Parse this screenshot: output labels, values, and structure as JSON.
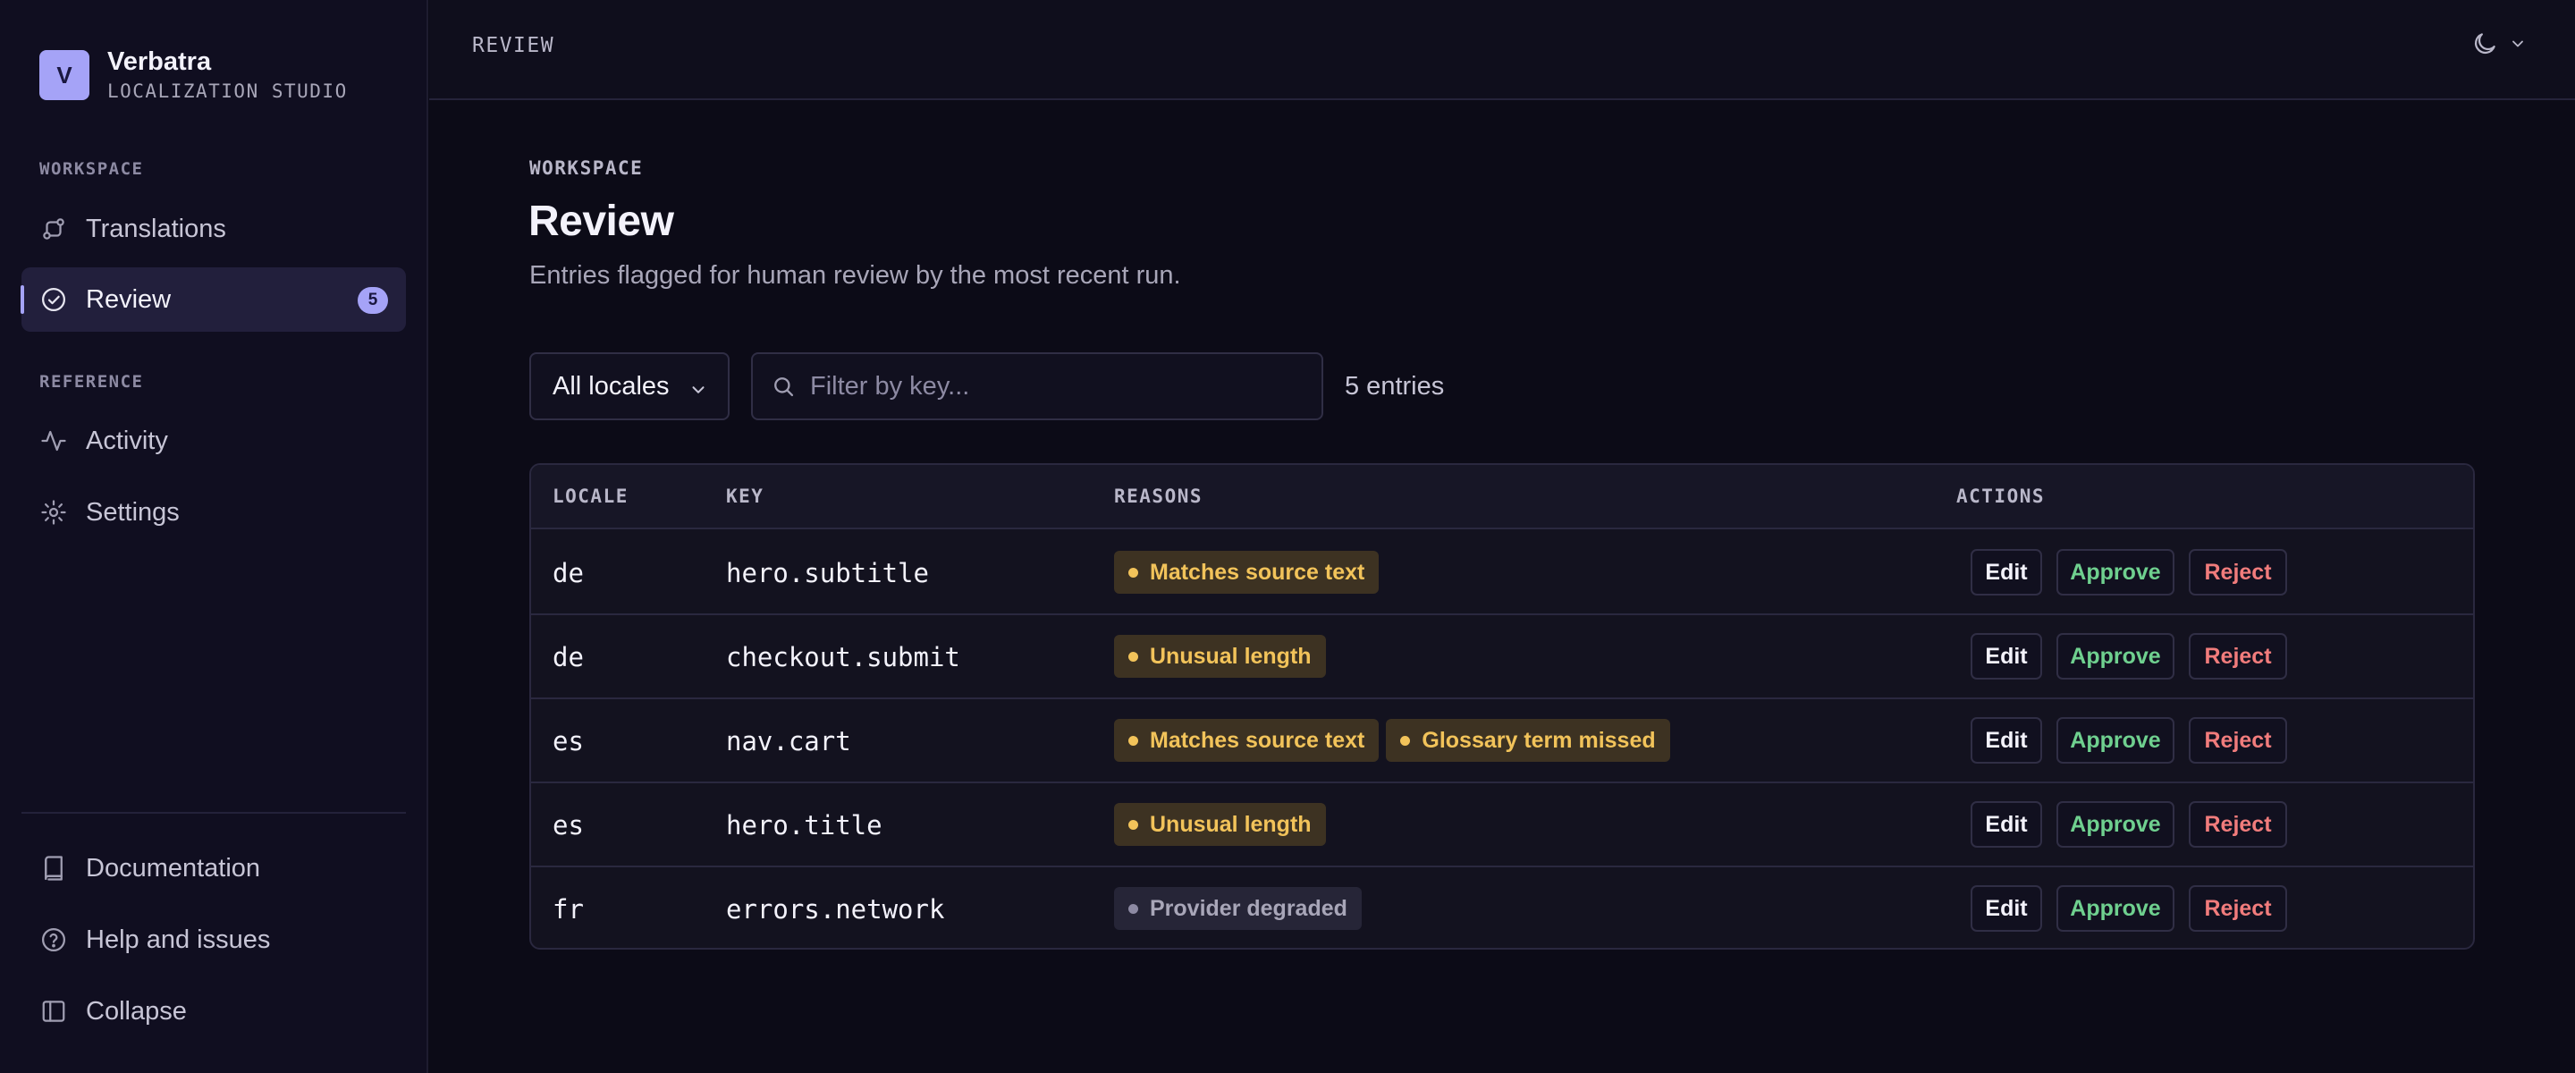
{
  "brand": {
    "logo_letter": "V",
    "name": "Verbatra",
    "subtitle": "LOCALIZATION STUDIO"
  },
  "sidebar": {
    "workspace_label": "WORKSPACE",
    "reference_label": "REFERENCE",
    "items": [
      {
        "label": "Translations",
        "icon": "translations-icon"
      },
      {
        "label": "Review",
        "icon": "check-circle-icon",
        "badge": "5",
        "active": true
      },
      {
        "label": "Activity",
        "icon": "activity-icon"
      },
      {
        "label": "Settings",
        "icon": "gear-icon"
      }
    ],
    "footer_items": [
      {
        "label": "Documentation",
        "icon": "book-icon"
      },
      {
        "label": "Help and issues",
        "icon": "help-circle-icon"
      },
      {
        "label": "Collapse",
        "icon": "sidebar-collapse-icon"
      }
    ]
  },
  "topbar": {
    "title": "REVIEW",
    "theme_icon": "moon-icon"
  },
  "main": {
    "eyebrow": "WORKSPACE",
    "title": "Review",
    "subtitle": "Entries flagged for human review by the most recent run.",
    "filters": {
      "locale_select": "All locales",
      "search_placeholder": "Filter by key...",
      "entries_count": "5 entries"
    },
    "table": {
      "headers": {
        "locale": "LOCALE",
        "key": "KEY",
        "reasons": "REASONS",
        "actions": "ACTIONS"
      },
      "actions": {
        "edit": "Edit",
        "approve": "Approve",
        "reject": "Reject"
      },
      "rows": [
        {
          "locale": "de",
          "key": "hero.subtitle",
          "reasons": [
            "Matches source text"
          ]
        },
        {
          "locale": "de",
          "key": "checkout.submit",
          "reasons": [
            "Unusual length"
          ]
        },
        {
          "locale": "es",
          "key": "nav.cart",
          "reasons": [
            "Matches source text",
            "Glossary term missed"
          ]
        },
        {
          "locale": "es",
          "key": "hero.title",
          "reasons": [
            "Unusual length"
          ]
        },
        {
          "locale": "fr",
          "key": "errors.network",
          "reasons": [
            "Provider degraded"
          ]
        }
      ]
    }
  },
  "colors": {
    "accent": "#a5a3f7",
    "warning": "#f2c35a",
    "approve": "#6fd08f",
    "reject": "#f17c7c",
    "background": "#0c0b17"
  }
}
